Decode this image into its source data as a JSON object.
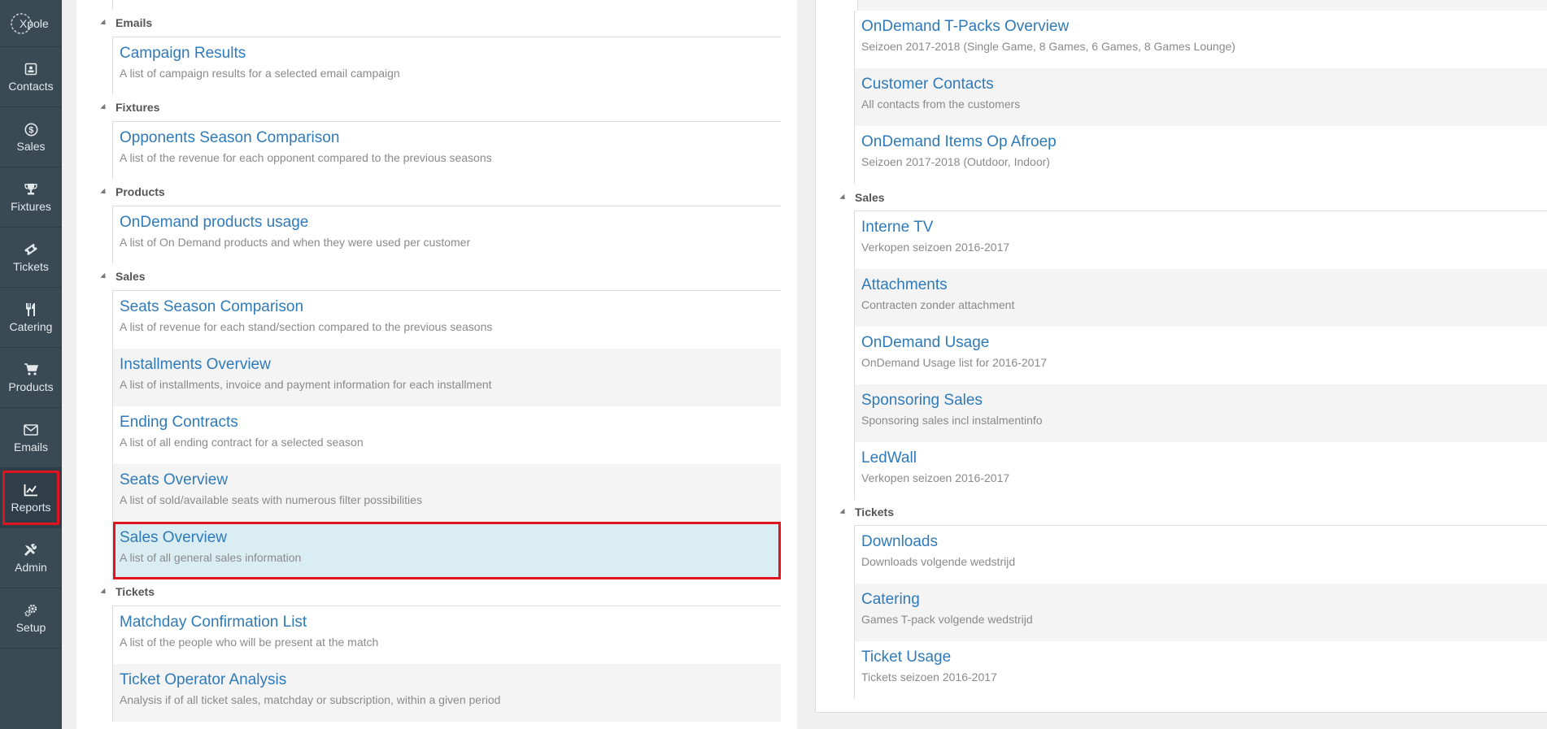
{
  "sidebar": {
    "logo": "Xpole",
    "items": [
      {
        "label": "Contacts",
        "icon": "contact-card-icon"
      },
      {
        "label": "Sales",
        "icon": "dollar-icon"
      },
      {
        "label": "Fixtures",
        "icon": "trophy-icon"
      },
      {
        "label": "Tickets",
        "icon": "ticket-icon"
      },
      {
        "label": "Catering",
        "icon": "cutlery-icon"
      },
      {
        "label": "Products",
        "icon": "cart-icon"
      },
      {
        "label": "Emails",
        "icon": "envelope-icon"
      },
      {
        "label": "Reports",
        "icon": "chart-icon",
        "active": true
      },
      {
        "label": "Admin",
        "icon": "tools-icon"
      },
      {
        "label": "Setup",
        "icon": "gears-icon"
      }
    ]
  },
  "left": {
    "sections": [
      {
        "name": "Emails",
        "items": [
          {
            "title": "Campaign Results",
            "desc": "A list of campaign results for a selected email campaign"
          }
        ]
      },
      {
        "name": "Fixtures",
        "items": [
          {
            "title": "Opponents Season Comparison",
            "desc": "A list of the revenue for each opponent compared to the previous seasons"
          }
        ]
      },
      {
        "name": "Products",
        "items": [
          {
            "title": "OnDemand products usage",
            "desc": "A list of On Demand products and when they were used per customer"
          }
        ]
      },
      {
        "name": "Sales",
        "items": [
          {
            "title": "Seats Season Comparison",
            "desc": "A list of revenue for each stand/section compared to the previous seasons"
          },
          {
            "title": "Installments Overview",
            "desc": "A list of installments, invoice and payment information for each installment"
          },
          {
            "title": "Ending Contracts",
            "desc": "A list of all ending contract for a selected season"
          },
          {
            "title": "Seats Overview",
            "desc": "A list of sold/available seats with numerous filter possibilities"
          },
          {
            "title": "Sales Overview",
            "desc": "A list of all general sales information",
            "selected": true
          }
        ]
      },
      {
        "name": "Tickets",
        "items": [
          {
            "title": "Matchday Confirmation List",
            "desc": "A list of the people who will be present at the match"
          },
          {
            "title": "Ticket Operator Analysis",
            "desc": "Analysis if of all ticket sales, matchday or subscription, within a given period"
          }
        ]
      }
    ]
  },
  "right": {
    "top_items": [
      {
        "title": "OnDemand T-Packs Overview",
        "desc": "Seizoen 2017-2018 (Single Game, 8 Games, 6 Games, 8 Games Lounge)"
      },
      {
        "title": "Customer Contacts",
        "desc": "All contacts from the customers"
      },
      {
        "title": "OnDemand Items Op Afroep",
        "desc": "Seizoen 2017-2018 (Outdoor, Indoor)"
      }
    ],
    "sections": [
      {
        "name": "Sales",
        "items": [
          {
            "title": "Interne TV",
            "desc": "Verkopen seizoen 2016-2017"
          },
          {
            "title": "Attachments",
            "desc": "Contracten zonder attachment"
          },
          {
            "title": "OnDemand Usage",
            "desc": "OnDemand Usage list for 2016-2017"
          },
          {
            "title": "Sponsoring Sales",
            "desc": "Sponsoring sales incl instalmentinfo"
          },
          {
            "title": "LedWall",
            "desc": "Verkopen seizoen 2016-2017"
          }
        ]
      },
      {
        "name": "Tickets",
        "items": [
          {
            "title": "Downloads",
            "desc": "Downloads volgende wedstrijd"
          },
          {
            "title": "Catering",
            "desc": "Games T-pack volgende wedstrijd"
          },
          {
            "title": "Ticket Usage",
            "desc": "Tickets seizoen 2016-2017"
          }
        ]
      }
    ]
  }
}
